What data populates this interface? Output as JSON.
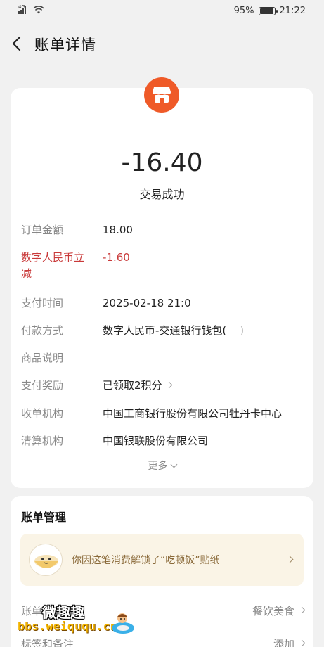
{
  "status_bar": {
    "network": "4G",
    "battery_percent": "95%",
    "battery_level": 0.95,
    "time": "21:22"
  },
  "header": {
    "title": "账单详情"
  },
  "transaction": {
    "amount": "-16.40",
    "status": "交易成功",
    "rows": [
      {
        "label": "订单金额",
        "value": "18.00"
      },
      {
        "label": "数字人民币立减",
        "value": "-1.60"
      },
      {
        "label": "支付时间",
        "value": "2025-02-18 21:0"
      },
      {
        "label": "付款方式",
        "value": "数字人民币-交通银行钱包("
      },
      {
        "label": "商品说明",
        "value": ""
      },
      {
        "label": "支付奖励",
        "value": "已领取2积分"
      },
      {
        "label": "收单机构",
        "value": "中国工商银行股份有限公司牡丹卡中心"
      },
      {
        "label": "清算机构",
        "value": "中国银联股份有限公司"
      }
    ],
    "more_label": "更多"
  },
  "manage": {
    "title": "账单管理",
    "sticker_text": "你因这笔消费解锁了“吃顿饭”贴纸",
    "category_label": "账单",
    "category_value": "餐饮美食",
    "tags_label": "标签和备注",
    "tags_value": "添加"
  },
  "watermark": {
    "line1": "微趣趣",
    "line2": "bbs.weiququ.cn"
  },
  "colors": {
    "accent": "#ef5a28",
    "discount": "#c93a3a",
    "banner_bg": "#faf4e6"
  }
}
